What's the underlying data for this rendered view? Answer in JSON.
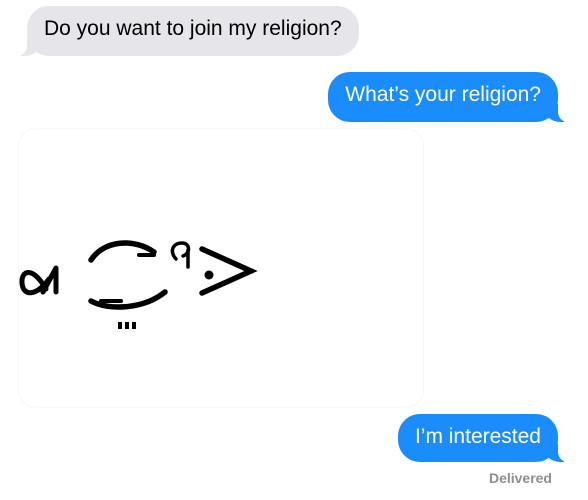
{
  "conversation": {
    "messages": [
      {
        "sender": "incoming",
        "text": "Do you want to join my religion?"
      },
      {
        "sender": "outgoing",
        "text": "What’s your religion?"
      },
      {
        "sender": "incoming",
        "type": "image",
        "description_icon": "fish-text-art-image"
      },
      {
        "sender": "outgoing",
        "text": "I’m interested"
      }
    ],
    "delivery_status": "Delivered"
  },
  "colors": {
    "incoming_bubble": "#e5e5ea",
    "outgoing_bubble": "#1b8cfb",
    "status_text": "#8e8e93"
  }
}
